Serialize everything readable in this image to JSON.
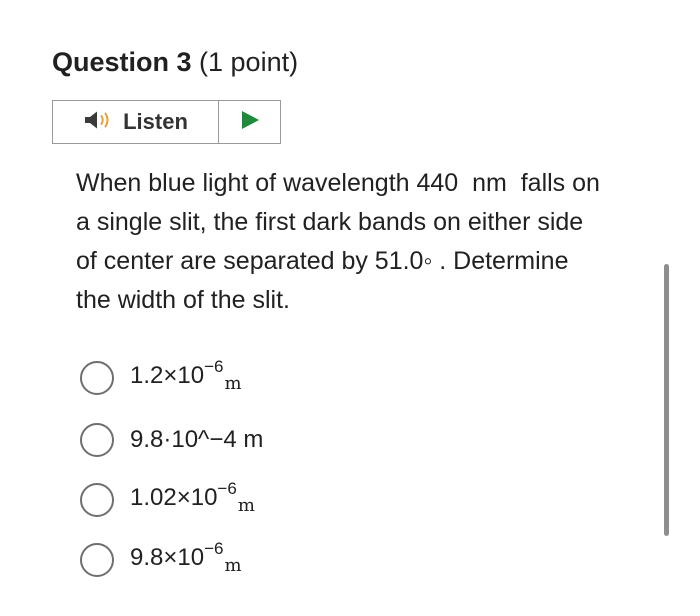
{
  "question": {
    "title": "Question 3",
    "points": " (1 point)"
  },
  "listen": {
    "label": "Listen",
    "speaker_icon": "speaker-icon",
    "play_icon": "play-icon",
    "play_color": "#1f8a3b"
  },
  "body": {
    "lines": [
      "When blue light of wavelength 440  nm  falls on",
      "a single slit, the first dark bands on either side",
      "of center are separated by 51.0◦ . Determine",
      "the width of the slit."
    ]
  },
  "options": [
    {
      "mantissa": "1.2×10",
      "exponent": "−6",
      "unit": "m",
      "plain": ""
    },
    {
      "mantissa": "",
      "exponent": "",
      "unit": "",
      "plain": "9.8·10^−4 m"
    },
    {
      "mantissa": "1.02×10",
      "exponent": "−6",
      "unit": "m",
      "plain": ""
    },
    {
      "mantissa": "9.8×10",
      "exponent": "−6",
      "unit": "m",
      "plain": ""
    }
  ]
}
